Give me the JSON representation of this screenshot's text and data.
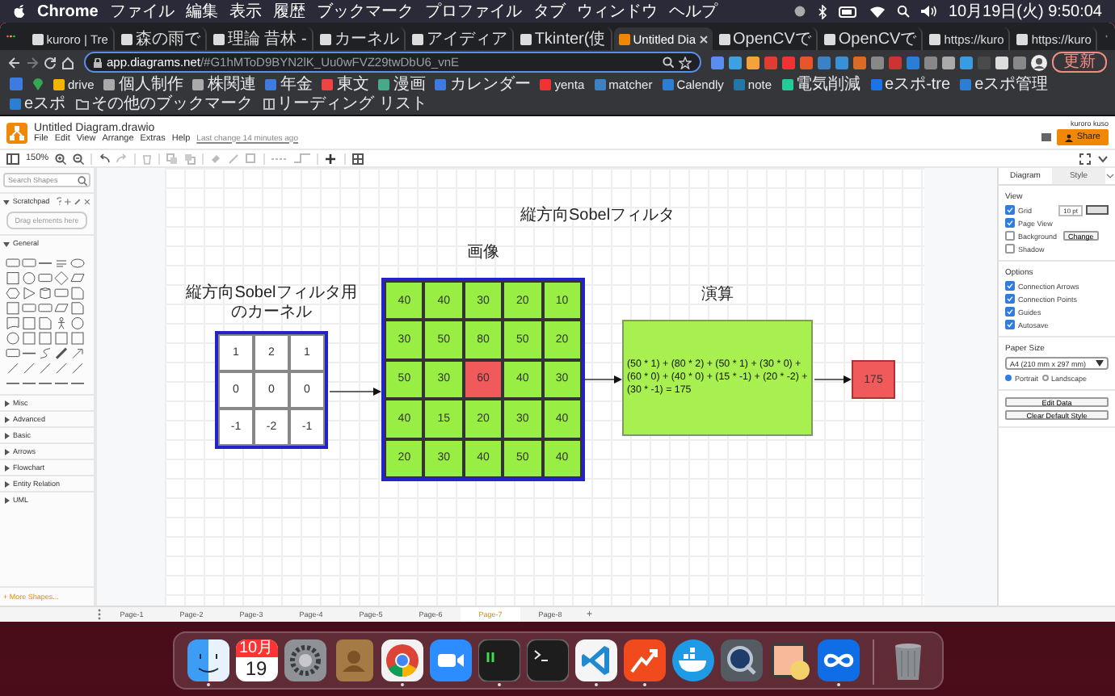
{
  "menubar": {
    "app": "Chrome",
    "items": [
      "ファイル",
      "編集",
      "表示",
      "履歴",
      "ブックマーク",
      "プロファイル",
      "タブ",
      "ウィンドウ",
      "ヘルプ"
    ],
    "clock": "10月19日(火) 9:50:04"
  },
  "browser": {
    "tabs": [
      {
        "title": "kuroro | Tre",
        "selected": false
      },
      {
        "title": "森の雨で",
        "selected": false
      },
      {
        "title": "理論 昔林 -",
        "selected": false
      },
      {
        "title": "カーネル",
        "selected": false
      },
      {
        "title": "アイディア",
        "selected": false
      },
      {
        "title": "Tkinter(使",
        "selected": false
      },
      {
        "title": "Untitled Dia",
        "selected": true
      },
      {
        "title": "OpenCVで",
        "selected": false
      },
      {
        "title": "OpenCVで",
        "selected": false
      },
      {
        "title": "https://kuro",
        "selected": false
      },
      {
        "title": "https://kuro",
        "selected": false
      }
    ],
    "address": {
      "host": "app.diagrams.net",
      "path": "/#G1hMToD9BYN2lK_Uu0wFVZ29twDbU6_vnE"
    },
    "update_button": "更新",
    "bookmarks": [
      "drive",
      "個人制作",
      "株関連",
      "年金",
      "東文",
      "漫画",
      "カレンダー",
      "yenta",
      "matcher",
      "Calendly",
      "note",
      "電気削減",
      "eスポ-tre",
      "eスポ管理",
      "eスポ"
    ],
    "other_bookmarks": "その他のブックマーク",
    "reading_list": "リーディング リスト"
  },
  "drawio": {
    "file_name": "Untitled Diagram.drawio",
    "menu": [
      "File",
      "Edit",
      "View",
      "Arrange",
      "Extras",
      "Help"
    ],
    "last_change": "Last change 14 minutes ago",
    "user": "kuroro kuso",
    "share": "Share",
    "zoom": "150%",
    "sidebar": {
      "search_placeholder": "Search Shapes",
      "scratchpad": {
        "title": "Scratchpad",
        "expanded": true,
        "drop_hint": "Drag elements here"
      },
      "sections": [
        {
          "title": "General",
          "expanded": true
        },
        {
          "title": "Misc",
          "expanded": false
        },
        {
          "title": "Advanced",
          "expanded": false
        },
        {
          "title": "Basic",
          "expanded": false
        },
        {
          "title": "Arrows",
          "expanded": false
        },
        {
          "title": "Flowchart",
          "expanded": false
        },
        {
          "title": "Entity Relation",
          "expanded": false
        },
        {
          "title": "UML",
          "expanded": false
        }
      ],
      "more_shapes": "+ More Shapes..."
    },
    "diagram": {
      "title": "縦方向Sobelフィルタ",
      "kernel_label": [
        "縦方向Sobelフィルタ用",
        "のカーネル"
      ],
      "kernel": [
        [
          "1",
          "2",
          "1"
        ],
        [
          "0",
          "0",
          "0"
        ],
        [
          "-1",
          "-2",
          "-1"
        ]
      ],
      "image_label": "画像",
      "image": [
        [
          {
            "v": "40",
            "highlighted": false
          },
          {
            "v": "40",
            "highlighted": false
          },
          {
            "v": "30",
            "highlighted": false
          },
          {
            "v": "20",
            "highlighted": false
          },
          {
            "v": "10",
            "highlighted": false
          }
        ],
        [
          {
            "v": "30",
            "highlighted": false
          },
          {
            "v": "50",
            "highlighted": false
          },
          {
            "v": "80",
            "highlighted": false
          },
          {
            "v": "50",
            "highlighted": false
          },
          {
            "v": "20",
            "highlighted": false
          }
        ],
        [
          {
            "v": "50",
            "highlighted": false
          },
          {
            "v": "30",
            "highlighted": false
          },
          {
            "v": "60",
            "highlighted": true
          },
          {
            "v": "40",
            "highlighted": false
          },
          {
            "v": "30",
            "highlighted": false
          }
        ],
        [
          {
            "v": "40",
            "highlighted": false
          },
          {
            "v": "15",
            "highlighted": false
          },
          {
            "v": "20",
            "highlighted": false
          },
          {
            "v": "30",
            "highlighted": false
          },
          {
            "v": "40",
            "highlighted": false
          }
        ],
        [
          {
            "v": "20",
            "highlighted": false
          },
          {
            "v": "30",
            "highlighted": false
          },
          {
            "v": "40",
            "highlighted": false
          },
          {
            "v": "50",
            "highlighted": false
          },
          {
            "v": "40",
            "highlighted": false
          }
        ]
      ],
      "compute_label": "演算",
      "formula": "(50 * 1) + (80 * 2) + (50 * 1) + (30 * 0) + (60 * 0) + (40 * 0) + (15 * -1) + (20 * -2) + (30 * -1) = 175",
      "result": "175"
    },
    "format_panel": {
      "tabs": [
        {
          "label": "Diagram",
          "selected": true
        },
        {
          "label": "Style",
          "selected": false
        }
      ],
      "view_title": "View",
      "view_options": [
        {
          "label": "Grid",
          "checked": true,
          "value": "10 pt"
        },
        {
          "label": "Page View",
          "checked": true
        },
        {
          "label": "Background",
          "checked": false,
          "button": "Change"
        },
        {
          "label": "Shadow",
          "checked": false
        }
      ],
      "options_title": "Options",
      "options": [
        {
          "label": "Connection Arrows",
          "checked": true
        },
        {
          "label": "Connection Points",
          "checked": true
        },
        {
          "label": "Guides",
          "checked": true
        },
        {
          "label": "Autosave",
          "checked": true
        }
      ],
      "paper_size_title": "Paper Size",
      "paper_size": "A4 (210 mm x 297 mm)",
      "orientations": [
        {
          "label": "Portrait",
          "selected": true
        },
        {
          "label": "Landscape",
          "selected": false
        }
      ],
      "buttons": [
        "Edit Data",
        "Clear Default Style"
      ]
    },
    "pages": [
      {
        "label": "Page-1",
        "selected": false
      },
      {
        "label": "Page-2",
        "selected": false
      },
      {
        "label": "Page-3",
        "selected": false
      },
      {
        "label": "Page-4",
        "selected": false
      },
      {
        "label": "Page-5",
        "selected": false
      },
      {
        "label": "Page-6",
        "selected": false
      },
      {
        "label": "Page-7",
        "selected": true
      },
      {
        "label": "Page-8",
        "selected": false
      }
    ],
    "add_page": "+"
  },
  "dock": [
    {
      "kind": "finder",
      "running": true
    },
    {
      "kind": "calendar",
      "month": "10月",
      "day": "19",
      "running": false
    },
    {
      "kind": "settings",
      "running": false
    },
    {
      "kind": "contacts",
      "running": false
    },
    {
      "kind": "chrome",
      "running": true
    },
    {
      "kind": "zoom",
      "running": false
    },
    {
      "kind": "terminal-green",
      "running": true
    },
    {
      "kind": "terminal",
      "running": false
    },
    {
      "kind": "vscode",
      "running": true
    },
    {
      "kind": "chart-app",
      "running": true
    },
    {
      "kind": "docker",
      "running": false
    },
    {
      "kind": "quicktime",
      "running": false
    },
    {
      "kind": "preview",
      "running": false
    },
    {
      "kind": "infinity",
      "running": true
    },
    {
      "kind": "trash",
      "running": false
    }
  ]
}
